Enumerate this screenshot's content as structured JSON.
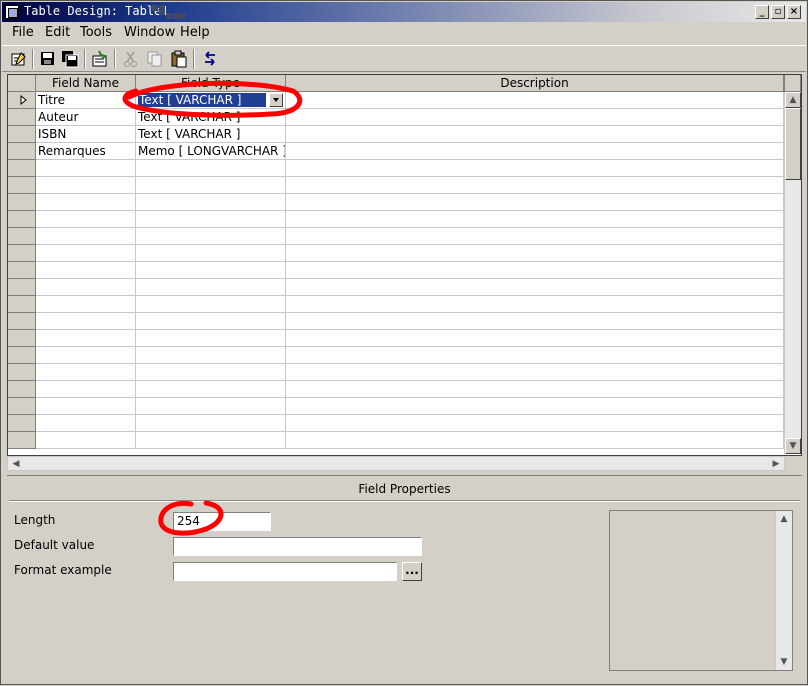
{
  "window": {
    "title": "Table Design: Table1"
  },
  "menu": [
    {
      "label": "File"
    },
    {
      "label": "Edit"
    },
    {
      "label": "Tools"
    },
    {
      "label": "Window"
    },
    {
      "label": "Help"
    }
  ],
  "toolbar": {
    "icons": [
      "edit-mode-icon",
      "save-icon",
      "save-all-icon",
      "index-design-icon",
      "cut-icon",
      "copy-icon",
      "paste-icon",
      "undo-icon"
    ]
  },
  "grid": {
    "headers": {
      "field_name": "Field Name",
      "field_type": "Field Type",
      "description": "Description"
    },
    "rows": [
      {
        "name": "Titre",
        "type": "Text [ VARCHAR ]",
        "description": ""
      },
      {
        "name": "Auteur",
        "type": "Text [ VARCHAR ]",
        "description": ""
      },
      {
        "name": "ISBN",
        "type": "Text [ VARCHAR ]",
        "description": ""
      },
      {
        "name": "Remarques",
        "type": "Memo [ LONGVARCHAR ]",
        "description": ""
      }
    ]
  },
  "field_properties": {
    "title": "Field Properties",
    "length_label": "Length",
    "length_value": "254",
    "default_label": "Default value",
    "default_value": "",
    "format_label": "Format example",
    "format_value": "",
    "format_button": "..."
  },
  "colors": {
    "selection": "#1f3e94",
    "annotation": "#ff0000"
  }
}
